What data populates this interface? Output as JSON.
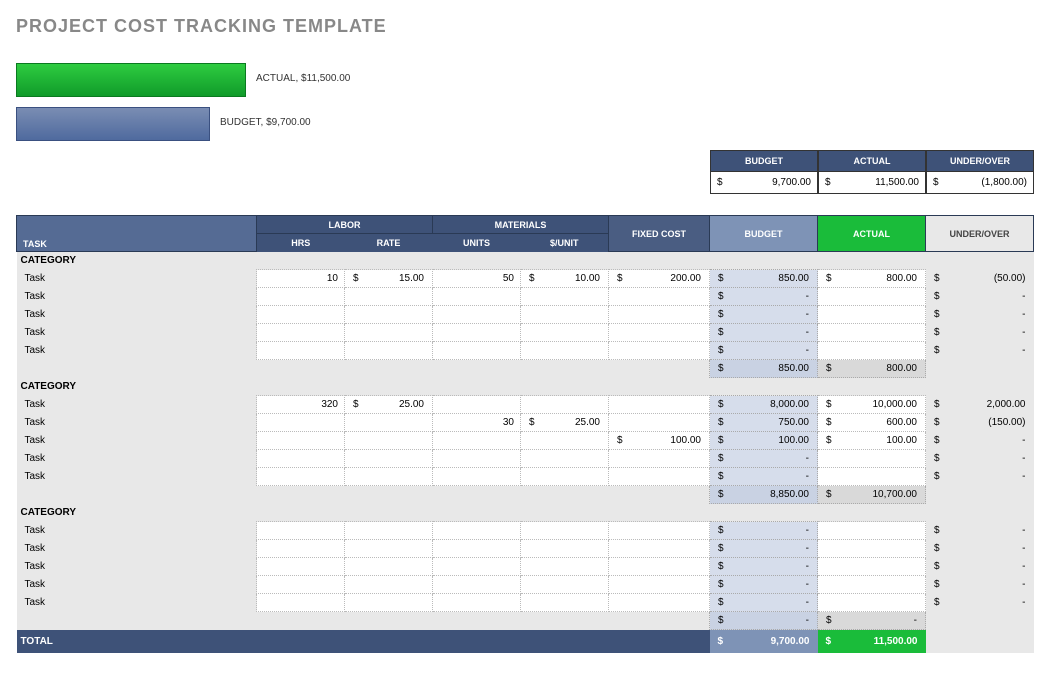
{
  "title": "PROJECT COST TRACKING TEMPLATE",
  "chart_data": {
    "type": "bar",
    "categories": [
      "ACTUAL",
      "BUDGET"
    ],
    "values": [
      11500,
      9700
    ],
    "labels": [
      "ACTUAL,  $11,500.00",
      "BUDGET,  $9,700.00"
    ]
  },
  "summary": {
    "headers": [
      "BUDGET",
      "ACTUAL",
      "UNDER/OVER"
    ],
    "values": [
      "9,700.00",
      "11,500.00",
      "(1,800.00)"
    ]
  },
  "columns": {
    "task": "TASK",
    "labor": "LABOR",
    "materials": "MATERIALS",
    "hrs": "HRS",
    "rate": "RATE",
    "units": "UNITS",
    "per_unit": "$/UNIT",
    "fixed": "FIXED COST",
    "budget": "BUDGET",
    "actual": "ACTUAL",
    "uo": "UNDER/OVER"
  },
  "categories": [
    {
      "name": "CATEGORY",
      "rows": [
        {
          "task": "Task",
          "hrs": "10",
          "rate": "15.00",
          "units": "50",
          "per_unit": "10.00",
          "fixed": "200.00",
          "budget": "850.00",
          "actual": "800.00",
          "uo": "(50.00)"
        },
        {
          "task": "Task",
          "hrs": "",
          "rate": "",
          "units": "",
          "per_unit": "",
          "fixed": "",
          "budget": "-",
          "actual": "",
          "uo": "-"
        },
        {
          "task": "Task",
          "hrs": "",
          "rate": "",
          "units": "",
          "per_unit": "",
          "fixed": "",
          "budget": "-",
          "actual": "",
          "uo": "-"
        },
        {
          "task": "Task",
          "hrs": "",
          "rate": "",
          "units": "",
          "per_unit": "",
          "fixed": "",
          "budget": "-",
          "actual": "",
          "uo": "-"
        },
        {
          "task": "Task",
          "hrs": "",
          "rate": "",
          "units": "",
          "per_unit": "",
          "fixed": "",
          "budget": "-",
          "actual": "",
          "uo": "-"
        }
      ],
      "subtotal": {
        "budget": "850.00",
        "actual": "800.00"
      }
    },
    {
      "name": "CATEGORY",
      "rows": [
        {
          "task": "Task",
          "hrs": "320",
          "rate": "25.00",
          "units": "",
          "per_unit": "",
          "fixed": "",
          "budget": "8,000.00",
          "actual": "10,000.00",
          "uo": "2,000.00"
        },
        {
          "task": "Task",
          "hrs": "",
          "rate": "",
          "units": "30",
          "per_unit": "25.00",
          "fixed": "",
          "budget": "750.00",
          "actual": "600.00",
          "uo": "(150.00)"
        },
        {
          "task": "Task",
          "hrs": "",
          "rate": "",
          "units": "",
          "per_unit": "",
          "fixed": "100.00",
          "budget": "100.00",
          "actual": "100.00",
          "uo": "-"
        },
        {
          "task": "Task",
          "hrs": "",
          "rate": "",
          "units": "",
          "per_unit": "",
          "fixed": "",
          "budget": "-",
          "actual": "",
          "uo": "-"
        },
        {
          "task": "Task",
          "hrs": "",
          "rate": "",
          "units": "",
          "per_unit": "",
          "fixed": "",
          "budget": "-",
          "actual": "",
          "uo": "-"
        }
      ],
      "subtotal": {
        "budget": "8,850.00",
        "actual": "10,700.00"
      }
    },
    {
      "name": "CATEGORY",
      "rows": [
        {
          "task": "Task",
          "hrs": "",
          "rate": "",
          "units": "",
          "per_unit": "",
          "fixed": "",
          "budget": "-",
          "actual": "",
          "uo": "-"
        },
        {
          "task": "Task",
          "hrs": "",
          "rate": "",
          "units": "",
          "per_unit": "",
          "fixed": "",
          "budget": "-",
          "actual": "",
          "uo": "-"
        },
        {
          "task": "Task",
          "hrs": "",
          "rate": "",
          "units": "",
          "per_unit": "",
          "fixed": "",
          "budget": "-",
          "actual": "",
          "uo": "-"
        },
        {
          "task": "Task",
          "hrs": "",
          "rate": "",
          "units": "",
          "per_unit": "",
          "fixed": "",
          "budget": "-",
          "actual": "",
          "uo": "-"
        },
        {
          "task": "Task",
          "hrs": "",
          "rate": "",
          "units": "",
          "per_unit": "",
          "fixed": "",
          "budget": "-",
          "actual": "",
          "uo": "-"
        }
      ],
      "subtotal": {
        "budget": "-",
        "actual": "-"
      }
    }
  ],
  "total": {
    "label": "TOTAL",
    "budget": "9,700.00",
    "actual": "11,500.00"
  }
}
